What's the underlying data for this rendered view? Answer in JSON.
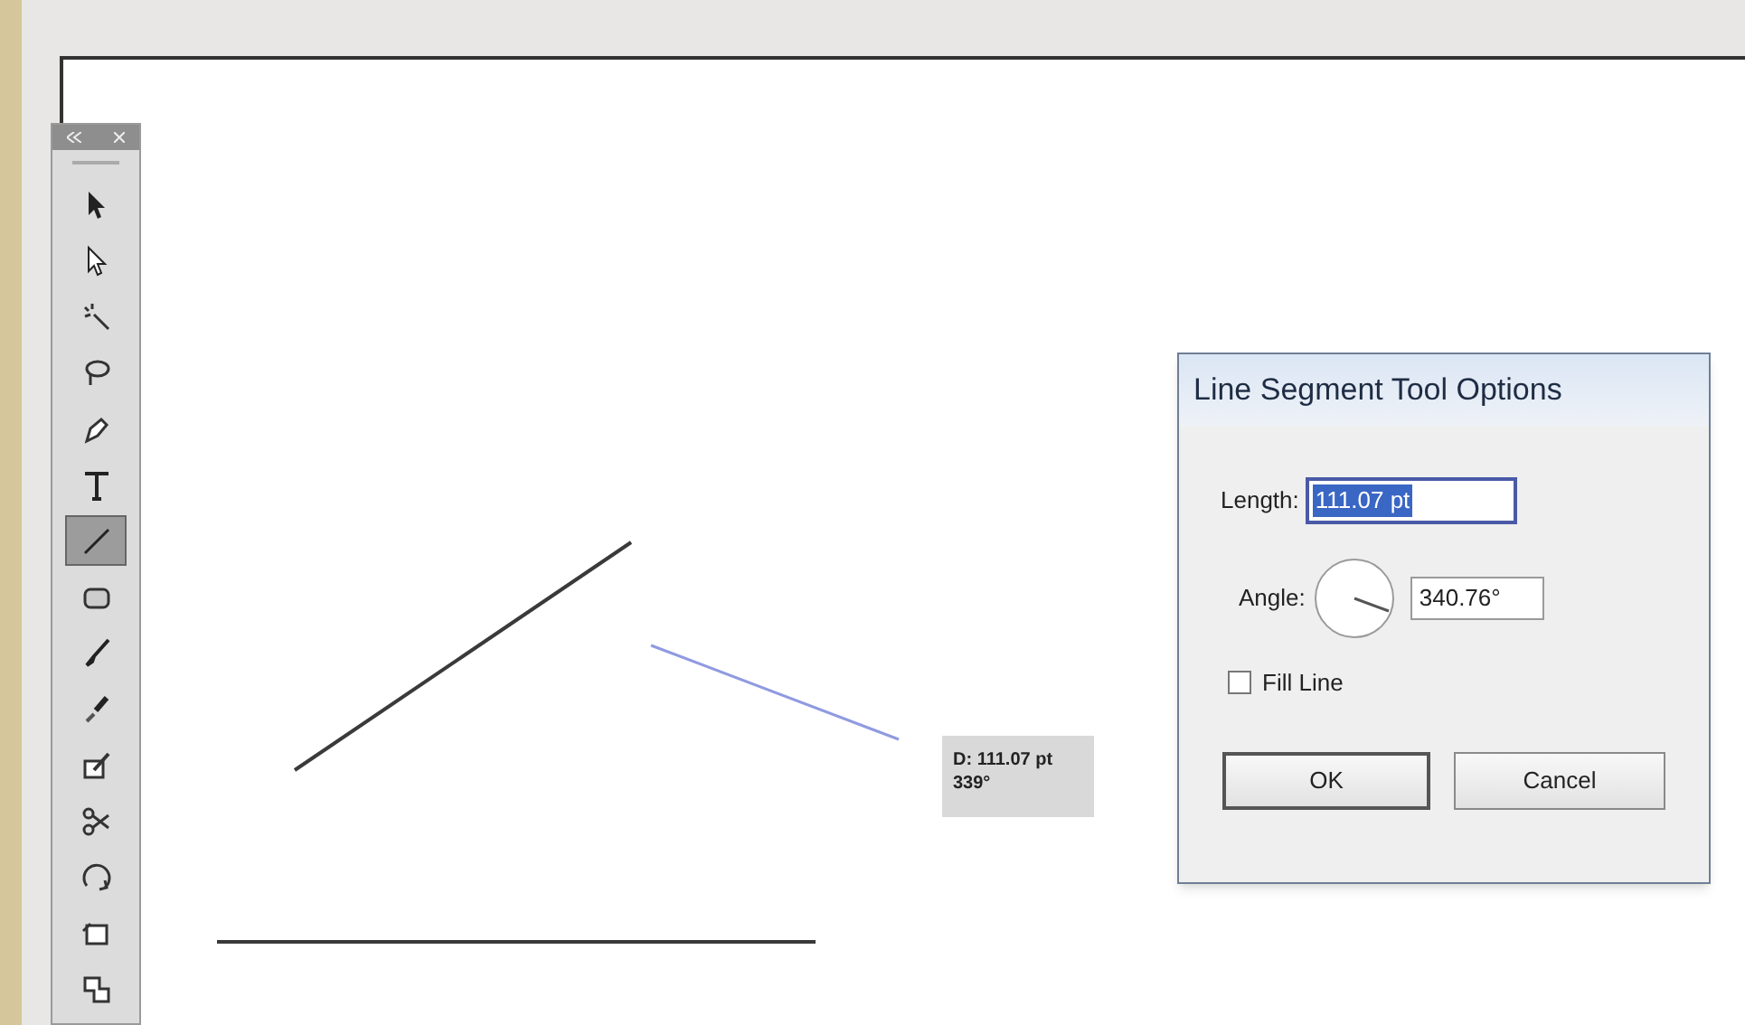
{
  "toolbar": {
    "tools": [
      {
        "kind": "selection",
        "selected": false
      },
      {
        "kind": "direct-selection",
        "selected": false
      },
      {
        "kind": "magic-wand",
        "selected": false
      },
      {
        "kind": "lasso",
        "selected": false
      },
      {
        "kind": "pen",
        "selected": false
      },
      {
        "kind": "type",
        "selected": false
      },
      {
        "kind": "line",
        "selected": true
      },
      {
        "kind": "rectangle",
        "selected": false
      },
      {
        "kind": "brush",
        "selected": false
      },
      {
        "kind": "blob-brush",
        "selected": false
      },
      {
        "kind": "eraser",
        "selected": false
      },
      {
        "kind": "scissors",
        "selected": false
      },
      {
        "kind": "rotate",
        "selected": false
      },
      {
        "kind": "free-transform",
        "selected": false
      },
      {
        "kind": "shape-builder",
        "selected": false
      }
    ]
  },
  "tooltip": {
    "lines": [
      "D: 111.07 pt",
      "339°"
    ]
  },
  "dialog": {
    "title": "Line Segment Tool Options",
    "length": {
      "label": "Length:",
      "value": "111.07 pt"
    },
    "angle": {
      "label": "Angle:",
      "value": "340.76°"
    },
    "fill_line": {
      "label": "Fill Line",
      "checked": false
    },
    "buttons": [
      "OK",
      "Cancel"
    ]
  }
}
